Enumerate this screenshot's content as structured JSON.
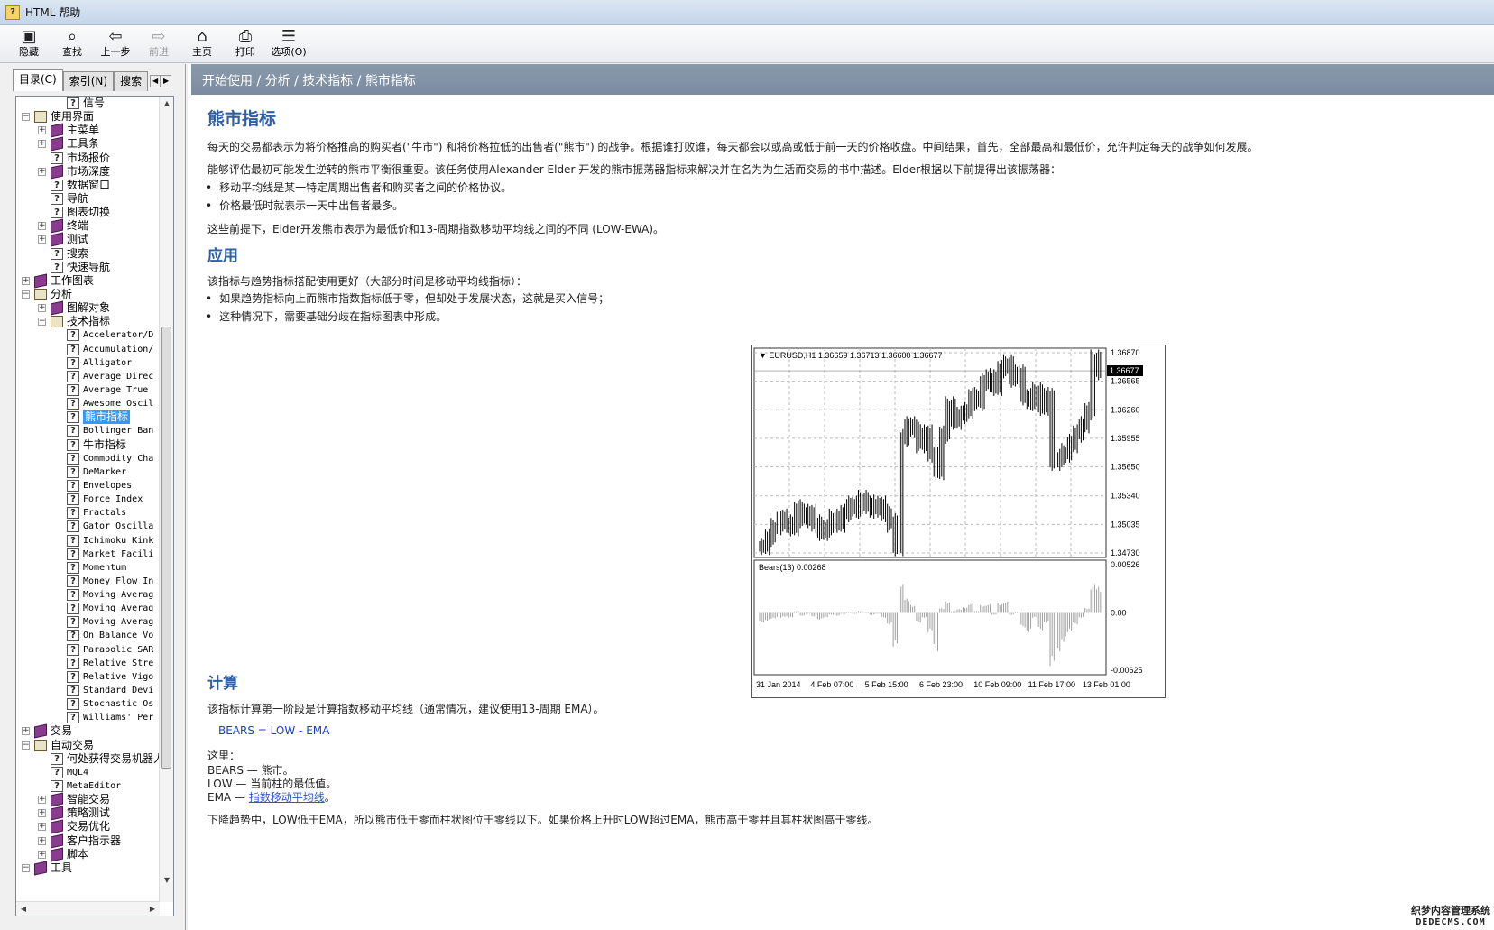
{
  "window": {
    "title": "HTML 帮助",
    "icon": "help-book-icon"
  },
  "toolbar": {
    "hide": "隐藏",
    "find": "查找",
    "back": "上一步",
    "forward": "前进",
    "home": "主页",
    "print": "打印",
    "options": "选项(O)"
  },
  "tabs": {
    "contents": "目录(C)",
    "index": "索引(N)",
    "search": "搜索"
  },
  "tree": [
    {
      "label": "信号",
      "level": 2,
      "icon": "page",
      "expander": ""
    },
    {
      "label": "使用界面",
      "level": 0,
      "icon": "openbook",
      "expander": "−"
    },
    {
      "label": "主菜单",
      "level": 1,
      "icon": "book",
      "expander": "+"
    },
    {
      "label": "工具条",
      "level": 1,
      "icon": "book",
      "expander": "+"
    },
    {
      "label": "市场报价",
      "level": 1,
      "icon": "page",
      "expander": ""
    },
    {
      "label": "市场深度",
      "level": 1,
      "icon": "book",
      "expander": "+"
    },
    {
      "label": "数据窗口",
      "level": 1,
      "icon": "page",
      "expander": ""
    },
    {
      "label": "导航",
      "level": 1,
      "icon": "page",
      "expander": ""
    },
    {
      "label": "图表切换",
      "level": 1,
      "icon": "page",
      "expander": ""
    },
    {
      "label": "终端",
      "level": 1,
      "icon": "book",
      "expander": "+"
    },
    {
      "label": "测试",
      "level": 1,
      "icon": "book",
      "expander": "+"
    },
    {
      "label": "搜索",
      "level": 1,
      "icon": "page",
      "expander": ""
    },
    {
      "label": "快速导航",
      "level": 1,
      "icon": "page",
      "expander": ""
    },
    {
      "label": "工作图表",
      "level": 0,
      "icon": "book",
      "expander": "+"
    },
    {
      "label": "分析",
      "level": 0,
      "icon": "openbook",
      "expander": "−"
    },
    {
      "label": "图解对象",
      "level": 1,
      "icon": "book",
      "expander": "+"
    },
    {
      "label": "技术指标",
      "level": 1,
      "icon": "openbook",
      "expander": "−"
    },
    {
      "label": "Accelerator/D",
      "level": 2,
      "icon": "page",
      "expander": "",
      "mono": true
    },
    {
      "label": "Accumulation/",
      "level": 2,
      "icon": "page",
      "expander": "",
      "mono": true
    },
    {
      "label": "Alligator",
      "level": 2,
      "icon": "page",
      "expander": "",
      "mono": true
    },
    {
      "label": "Average Direc",
      "level": 2,
      "icon": "page",
      "expander": "",
      "mono": true
    },
    {
      "label": "Average True",
      "level": 2,
      "icon": "page",
      "expander": "",
      "mono": true
    },
    {
      "label": "Awesome Oscil",
      "level": 2,
      "icon": "page",
      "expander": "",
      "mono": true
    },
    {
      "label": "熊市指标",
      "level": 2,
      "icon": "page",
      "expander": "",
      "selected": true
    },
    {
      "label": "Bollinger Ban",
      "level": 2,
      "icon": "page",
      "expander": "",
      "mono": true
    },
    {
      "label": "牛市指标",
      "level": 2,
      "icon": "page",
      "expander": ""
    },
    {
      "label": "Commodity Cha",
      "level": 2,
      "icon": "page",
      "expander": "",
      "mono": true
    },
    {
      "label": "DeMarker",
      "level": 2,
      "icon": "page",
      "expander": "",
      "mono": true
    },
    {
      "label": "Envelopes",
      "level": 2,
      "icon": "page",
      "expander": "",
      "mono": true
    },
    {
      "label": "Force Index",
      "level": 2,
      "icon": "page",
      "expander": "",
      "mono": true
    },
    {
      "label": "Fractals",
      "level": 2,
      "icon": "page",
      "expander": "",
      "mono": true
    },
    {
      "label": "Gator Oscilla",
      "level": 2,
      "icon": "page",
      "expander": "",
      "mono": true
    },
    {
      "label": "Ichimoku Kink",
      "level": 2,
      "icon": "page",
      "expander": "",
      "mono": true
    },
    {
      "label": "Market Facili",
      "level": 2,
      "icon": "page",
      "expander": "",
      "mono": true
    },
    {
      "label": "Momentum",
      "level": 2,
      "icon": "page",
      "expander": "",
      "mono": true
    },
    {
      "label": "Money Flow In",
      "level": 2,
      "icon": "page",
      "expander": "",
      "mono": true
    },
    {
      "label": "Moving Averag",
      "level": 2,
      "icon": "page",
      "expander": "",
      "mono": true
    },
    {
      "label": "Moving Averag",
      "level": 2,
      "icon": "page",
      "expander": "",
      "mono": true
    },
    {
      "label": "Moving Averag",
      "level": 2,
      "icon": "page",
      "expander": "",
      "mono": true
    },
    {
      "label": "On Balance Vo",
      "level": 2,
      "icon": "page",
      "expander": "",
      "mono": true
    },
    {
      "label": "Parabolic SAR",
      "level": 2,
      "icon": "page",
      "expander": "",
      "mono": true
    },
    {
      "label": "Relative Stre",
      "level": 2,
      "icon": "page",
      "expander": "",
      "mono": true
    },
    {
      "label": "Relative Vigo",
      "level": 2,
      "icon": "page",
      "expander": "",
      "mono": true
    },
    {
      "label": "Standard Devi",
      "level": 2,
      "icon": "page",
      "expander": "",
      "mono": true
    },
    {
      "label": "Stochastic Os",
      "level": 2,
      "icon": "page",
      "expander": "",
      "mono": true
    },
    {
      "label": "Williams' Per",
      "level": 2,
      "icon": "page",
      "expander": "",
      "mono": true
    },
    {
      "label": "交易",
      "level": 0,
      "icon": "book",
      "expander": "+"
    },
    {
      "label": "自动交易",
      "level": 0,
      "icon": "openbook",
      "expander": "−"
    },
    {
      "label": "何处获得交易机器人",
      "level": 1,
      "icon": "page",
      "expander": ""
    },
    {
      "label": "MQL4",
      "level": 1,
      "icon": "page",
      "expander": "",
      "mono": true
    },
    {
      "label": "MetaEditor",
      "level": 1,
      "icon": "page",
      "expander": "",
      "mono": true
    },
    {
      "label": "智能交易",
      "level": 1,
      "icon": "book",
      "expander": "+"
    },
    {
      "label": "策略测试",
      "level": 1,
      "icon": "book",
      "expander": "+"
    },
    {
      "label": "交易优化",
      "level": 1,
      "icon": "book",
      "expander": "+"
    },
    {
      "label": "客户指示器",
      "level": 1,
      "icon": "book",
      "expander": "+"
    },
    {
      "label": "脚本",
      "level": 1,
      "icon": "book",
      "expander": "+"
    },
    {
      "label": "工具",
      "level": 0,
      "icon": "book",
      "expander": "−"
    }
  ],
  "breadcrumb": "开始使用 / 分析 / 技术指标 / 熊市指标",
  "article": {
    "title": "熊市指标",
    "intro": "每天的交易都表示为将价格推高的购买者(\"牛市\") 和将价格拉低的出售者(\"熊市\") 的战争。根据谁打败谁，每天都会以或高或低于前一天的价格收盘。中间结果，首先，全部最高和最低价，允许判定每天的战争如何发展。",
    "p2": "能够评估最初可能发生逆转的熊市平衡很重要。该任务使用Alexander Elder 开发的熊市振荡器指标来解决并在名为为生活而交易的书中描述。Elder根据以下前提得出该振荡器：",
    "b1": "移动平均线是某一特定周期出售者和购买者之间的价格协议。",
    "b2": "价格最低时就表示一天中出售者最多。",
    "p3": "这些前提下，Elder开发熊市表示为最低价和13-周期指数移动平均线之间的不同 (LOW-EWA)。",
    "h_apply": "应用",
    "apply_intro": "该指标与趋势指标搭配使用更好（大部分时间是移动平均线指标）：",
    "ab1": "如果趋势指标向上而熊市指数指标低于零，但却处于发展状态，这就是买入信号；",
    "ab2": "这种情况下，需要基础分歧在指标图表中形成。",
    "h_calc": "计算",
    "calc_intro": "该指标计算第一阶段是计算指数移动平均线（通常情况，建议使用13-周期 EMA）。",
    "formula": "BEARS = LOW - EMA",
    "where": "这里：",
    "w1": "BEARS — 熊市。",
    "w2": "LOW — 当前柱的最低值。",
    "w3_pre": "EMA — ",
    "w3_link": "指数移动平均线",
    "w3_post": "。",
    "closing": "下降趋势中，LOW低于EMA，所以熊市低于零而柱状图位于零线以下。如果价格上升时LOW超过EMA，熊市高于零并且其柱状图高于零线。"
  },
  "chart_data": {
    "type": "line",
    "title": "EURUSD,H1  1.36659 1.36713 1.36600 1.36677",
    "price_axis": [
      "1.36870",
      "1.36565",
      "1.36260",
      "1.35955",
      "1.35650",
      "1.35340",
      "1.35035",
      "1.34730"
    ],
    "current_price": "1.36677",
    "ylim": [
      1.3473,
      1.3687
    ],
    "grid": true,
    "indicator_title": "Bears(13) 0.00268",
    "indicator_axis": [
      "0.00526",
      "0.00",
      "-0.00625"
    ],
    "indicator_ylim": [
      -0.00625,
      0.00526
    ],
    "x_labels": [
      "31 Jan 2014",
      "4 Feb 07:00",
      "5 Feb 15:00",
      "6 Feb 23:00",
      "10 Feb 09:00",
      "11 Feb 17:00",
      "13 Feb 01:00"
    ],
    "price": [
      1.348,
      1.349,
      1.35,
      1.351,
      1.3505,
      1.35,
      1.352,
      1.351,
      1.3515,
      1.3505,
      1.3495,
      1.35,
      1.351,
      1.3505,
      1.3515,
      1.3525,
      1.352,
      1.353,
      1.3525,
      1.352,
      1.3525,
      1.3515,
      1.3505,
      1.348,
      1.3595,
      1.361,
      1.3605,
      1.359,
      1.36,
      1.358,
      1.356,
      1.36,
      1.363,
      1.3615,
      1.362,
      1.3625,
      1.364,
      1.3635,
      1.3655,
      1.366,
      1.365,
      1.367,
      1.3675,
      1.366,
      1.3665,
      1.364,
      1.3635,
      1.3645,
      1.363,
      1.364,
      1.357,
      1.3575,
      1.358,
      1.359,
      1.36,
      1.361,
      1.3625,
      1.368,
      1.3668
    ],
    "bears": [
      -0.001,
      -0.0008,
      -0.0006,
      -0.0005,
      -0.0004,
      -0.0005,
      0.0002,
      -0.0003,
      -0.0001,
      -0.0004,
      -0.0007,
      -0.0005,
      -0.0002,
      -0.0003,
      -0.0001,
      0.0001,
      -0.0001,
      0.0002,
      0.0001,
      -0.0002,
      -0.0001,
      -0.0005,
      -0.0012,
      -0.0035,
      0.003,
      0.0015,
      0.0008,
      -0.001,
      -0.0005,
      -0.002,
      -0.004,
      0.0005,
      0.0012,
      0.0002,
      0.0004,
      0.0006,
      0.001,
      0.0002,
      0.0008,
      0.0009,
      -0.0002,
      0.001,
      0.0012,
      -0.0002,
      0.0001,
      -0.0015,
      -0.002,
      -0.0005,
      -0.0018,
      -0.001,
      -0.0055,
      -0.004,
      -0.003,
      -0.002,
      -0.0012,
      -0.0005,
      0.0005,
      0.003,
      0.0027
    ]
  }
}
